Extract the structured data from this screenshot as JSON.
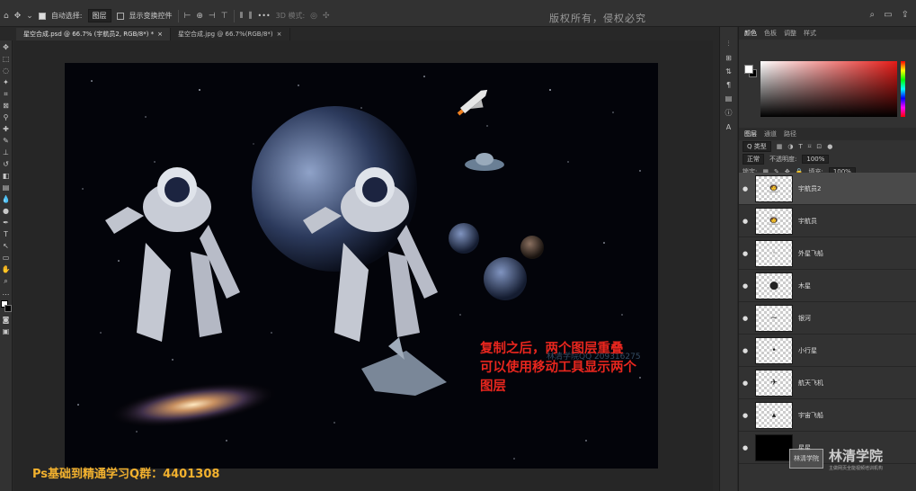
{
  "options_bar": {
    "auto_select_label": "自动选择:",
    "auto_select_value": "图层",
    "show_transform_label": "显示变换控件",
    "three_d_label": "3D 模式:",
    "more_label": "•••"
  },
  "watermark_top": "版权所有，侵权必究",
  "doc_tabs": [
    {
      "label": "星空合成.psd @ 66.7% (宇航员2, RGB/8*) *",
      "close": "×"
    },
    {
      "label": "星空合成.jpg @ 66.7%(RGB/8*)",
      "close": "×"
    }
  ],
  "annotation": {
    "line1": "复制之后，两个图层重叠",
    "line2": "可以使用移动工具显示两个",
    "line3": "图层"
  },
  "canvas_watermark": "林清学院QQ 209316275",
  "footer_text": "Ps基础到精通学习Q群：4401308",
  "panel": {
    "color_tabs": [
      "颜色",
      "色板",
      "调整",
      "样式"
    ],
    "layers_tabs": [
      "图层",
      "通道",
      "路径"
    ],
    "filter_label": "Q 类型",
    "blend_mode": "正常",
    "opacity_label": "不透明度:",
    "opacity_value": "100%",
    "lock_label": "锁定:",
    "fill_label": "填充:",
    "fill_value": "100%"
  },
  "layers": [
    {
      "name": "宇航员2",
      "selected": true
    },
    {
      "name": "宇航员",
      "selected": false
    },
    {
      "name": "外星飞船",
      "selected": false
    },
    {
      "name": "木星",
      "selected": false
    },
    {
      "name": "银河",
      "selected": false
    },
    {
      "name": "小行星",
      "selected": false
    },
    {
      "name": "航天飞机",
      "selected": false
    },
    {
      "name": "宇宙飞船",
      "selected": false
    },
    {
      "name": "星星",
      "selected": false
    }
  ],
  "logo": {
    "box": "林清学院",
    "name": "林清学院",
    "sub": "主做网页全能视频培训机构"
  },
  "colors": {
    "annotation": "#e8261e",
    "footer": "#f2b12e",
    "panel_bg": "#323232"
  }
}
